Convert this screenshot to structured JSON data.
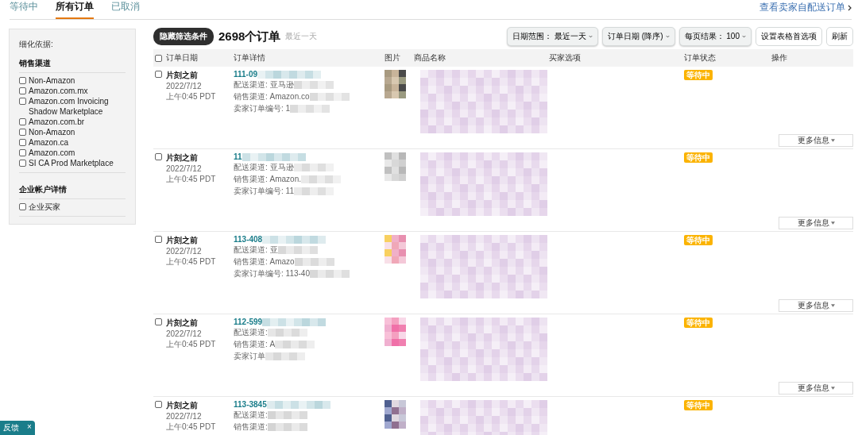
{
  "tabs": [
    {
      "label": "等待中",
      "selected": false
    },
    {
      "label": "所有订单",
      "selected": true
    },
    {
      "label": "已取消",
      "selected": false
    }
  ],
  "fbm_link": "查看卖家自配送订单",
  "sidebar": {
    "title": "细化依据:",
    "sections": [
      {
        "heading": "销售渠道",
        "options": [
          {
            "label": "Non-Amazon",
            "checked": false
          },
          {
            "label": "Amazon.com.mx",
            "checked": false
          },
          {
            "label": "Amazon.com Invoicing Shadow Marketplace",
            "checked": false
          },
          {
            "label": "Amazon.com.br",
            "checked": false
          },
          {
            "label": "Non-Amazon",
            "checked": false
          },
          {
            "label": "Amazon.ca",
            "checked": false
          },
          {
            "label": "Amazon.com",
            "checked": false
          },
          {
            "label": "SI CA Prod Marketplace",
            "checked": false
          }
        ]
      },
      {
        "heading": "企业帐户详情",
        "options": [
          {
            "label": "企业买家",
            "checked": false
          }
        ]
      }
    ]
  },
  "toolbar": {
    "hide_filters": "隐藏筛选条件",
    "count": "2698个订单",
    "range": "最近一天",
    "dropdowns": [
      {
        "label": "日期范围：",
        "value": "最近一天"
      },
      {
        "label": "订单日期 (降序)"
      },
      {
        "label": "每页结果：",
        "value": "100"
      }
    ],
    "buttons": [
      "设置表格首选项",
      "刷新"
    ]
  },
  "table": {
    "select_all": {
      "selected": false
    },
    "columns": [
      "订单日期",
      "订单详情",
      "图片",
      "商品名称",
      "买家选项",
      "订单状态",
      "操作"
    ],
    "rows": [
      {
        "selected": false,
        "age": "片刻之前",
        "date": "2022/7/12",
        "time": "上午0:45 PDT",
        "order_id": "111-09",
        "details": [
          "配送渠道: 亚马逊",
          "销售渠道: Amazon.co",
          "卖家订单编号: 1"
        ],
        "status": "等待中",
        "more": "更多信息"
      },
      {
        "selected": false,
        "age": "片刻之前",
        "date": "2022/7/12",
        "time": "上午0:45 PDT",
        "order_id": "11",
        "details": [
          "配送渠道: 亚马逊",
          "销售渠道: Amazon.",
          "卖家订单编号: 11"
        ],
        "status": "等待中",
        "more": "更多信息"
      },
      {
        "selected": false,
        "age": "片刻之前",
        "date": "2022/7/12",
        "time": "上午0:45 PDT",
        "order_id": "113-408",
        "details": [
          "配送渠道: 亚",
          "销售渠道: Amazo",
          "卖家订单编号: 113-40"
        ],
        "status": "等待中",
        "more": "更多信息"
      },
      {
        "selected": false,
        "age": "片刻之前",
        "date": "2022/7/12",
        "time": "上午0:45 PDT",
        "order_id": "112-599",
        "details": [
          "配送渠道:",
          "销售渠道: A",
          "卖家订单"
        ],
        "status": "等待中",
        "more": "更多信息"
      },
      {
        "selected": false,
        "age": "片刻之前",
        "date": "2022/7/12",
        "time": "上午0:45 PDT",
        "order_id": "113-3845",
        "details": [
          "配送渠道:",
          "销售渠道:"
        ],
        "status": "等待中"
      }
    ]
  },
  "feedback": {
    "label": "反馈",
    "close": "×"
  }
}
